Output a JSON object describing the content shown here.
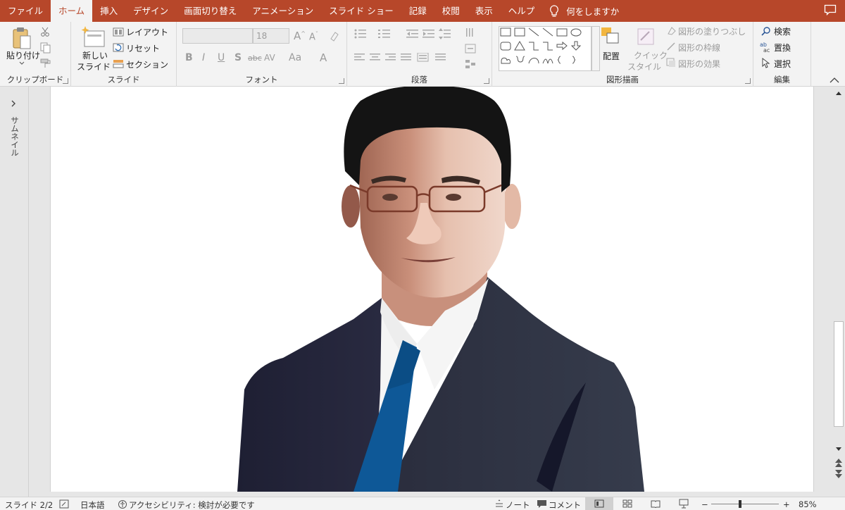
{
  "tabs": [
    "ファイル",
    "ホーム",
    "挿入",
    "デザイン",
    "画面切り替え",
    "アニメーション",
    "スライド ショー",
    "記録",
    "校閲",
    "表示",
    "ヘルプ"
  ],
  "active_tab": "ホーム",
  "tell_me": "何をしますか",
  "ribbon": {
    "clipboard": {
      "paste": "貼り付け",
      "label": "クリップボード"
    },
    "slides": {
      "new_line1": "新しい",
      "new_line2": "スライド",
      "layout": "レイアウト",
      "reset": "リセット",
      "section": "セクション",
      "label": "スライド"
    },
    "font": {
      "size": "18",
      "label": "フォント",
      "bold": "B",
      "italic": "I",
      "underline": "U",
      "shadow": "S",
      "strike": "abc",
      "spacing": "AV",
      "case": "Aa",
      "color": "A"
    },
    "paragraph": {
      "label": "段落"
    },
    "drawing": {
      "arrange": "配置",
      "quick_line1": "クイック",
      "quick_line2": "スタイル",
      "fill": "図形の塗りつぶし",
      "outline": "図形の枠線",
      "effects": "図形の効果",
      "label": "図形描画"
    },
    "editing": {
      "find": "検索",
      "replace": "置換",
      "select": "選択",
      "label": "編集"
    }
  },
  "thumbnails_label": "サムネイル",
  "status": {
    "slide": "スライド 2/2",
    "language": "日本語",
    "accessibility": "アクセシビリティ: 検討が必要です",
    "notes": "ノート",
    "comments": "コメント",
    "zoom": "85%"
  },
  "zoom_level": 0.85,
  "colors": {
    "accent": "#b7472a",
    "suit": "#2a2d3c",
    "tie": "#0e5897",
    "hair": "#141414",
    "skin": "#d9a48d"
  }
}
